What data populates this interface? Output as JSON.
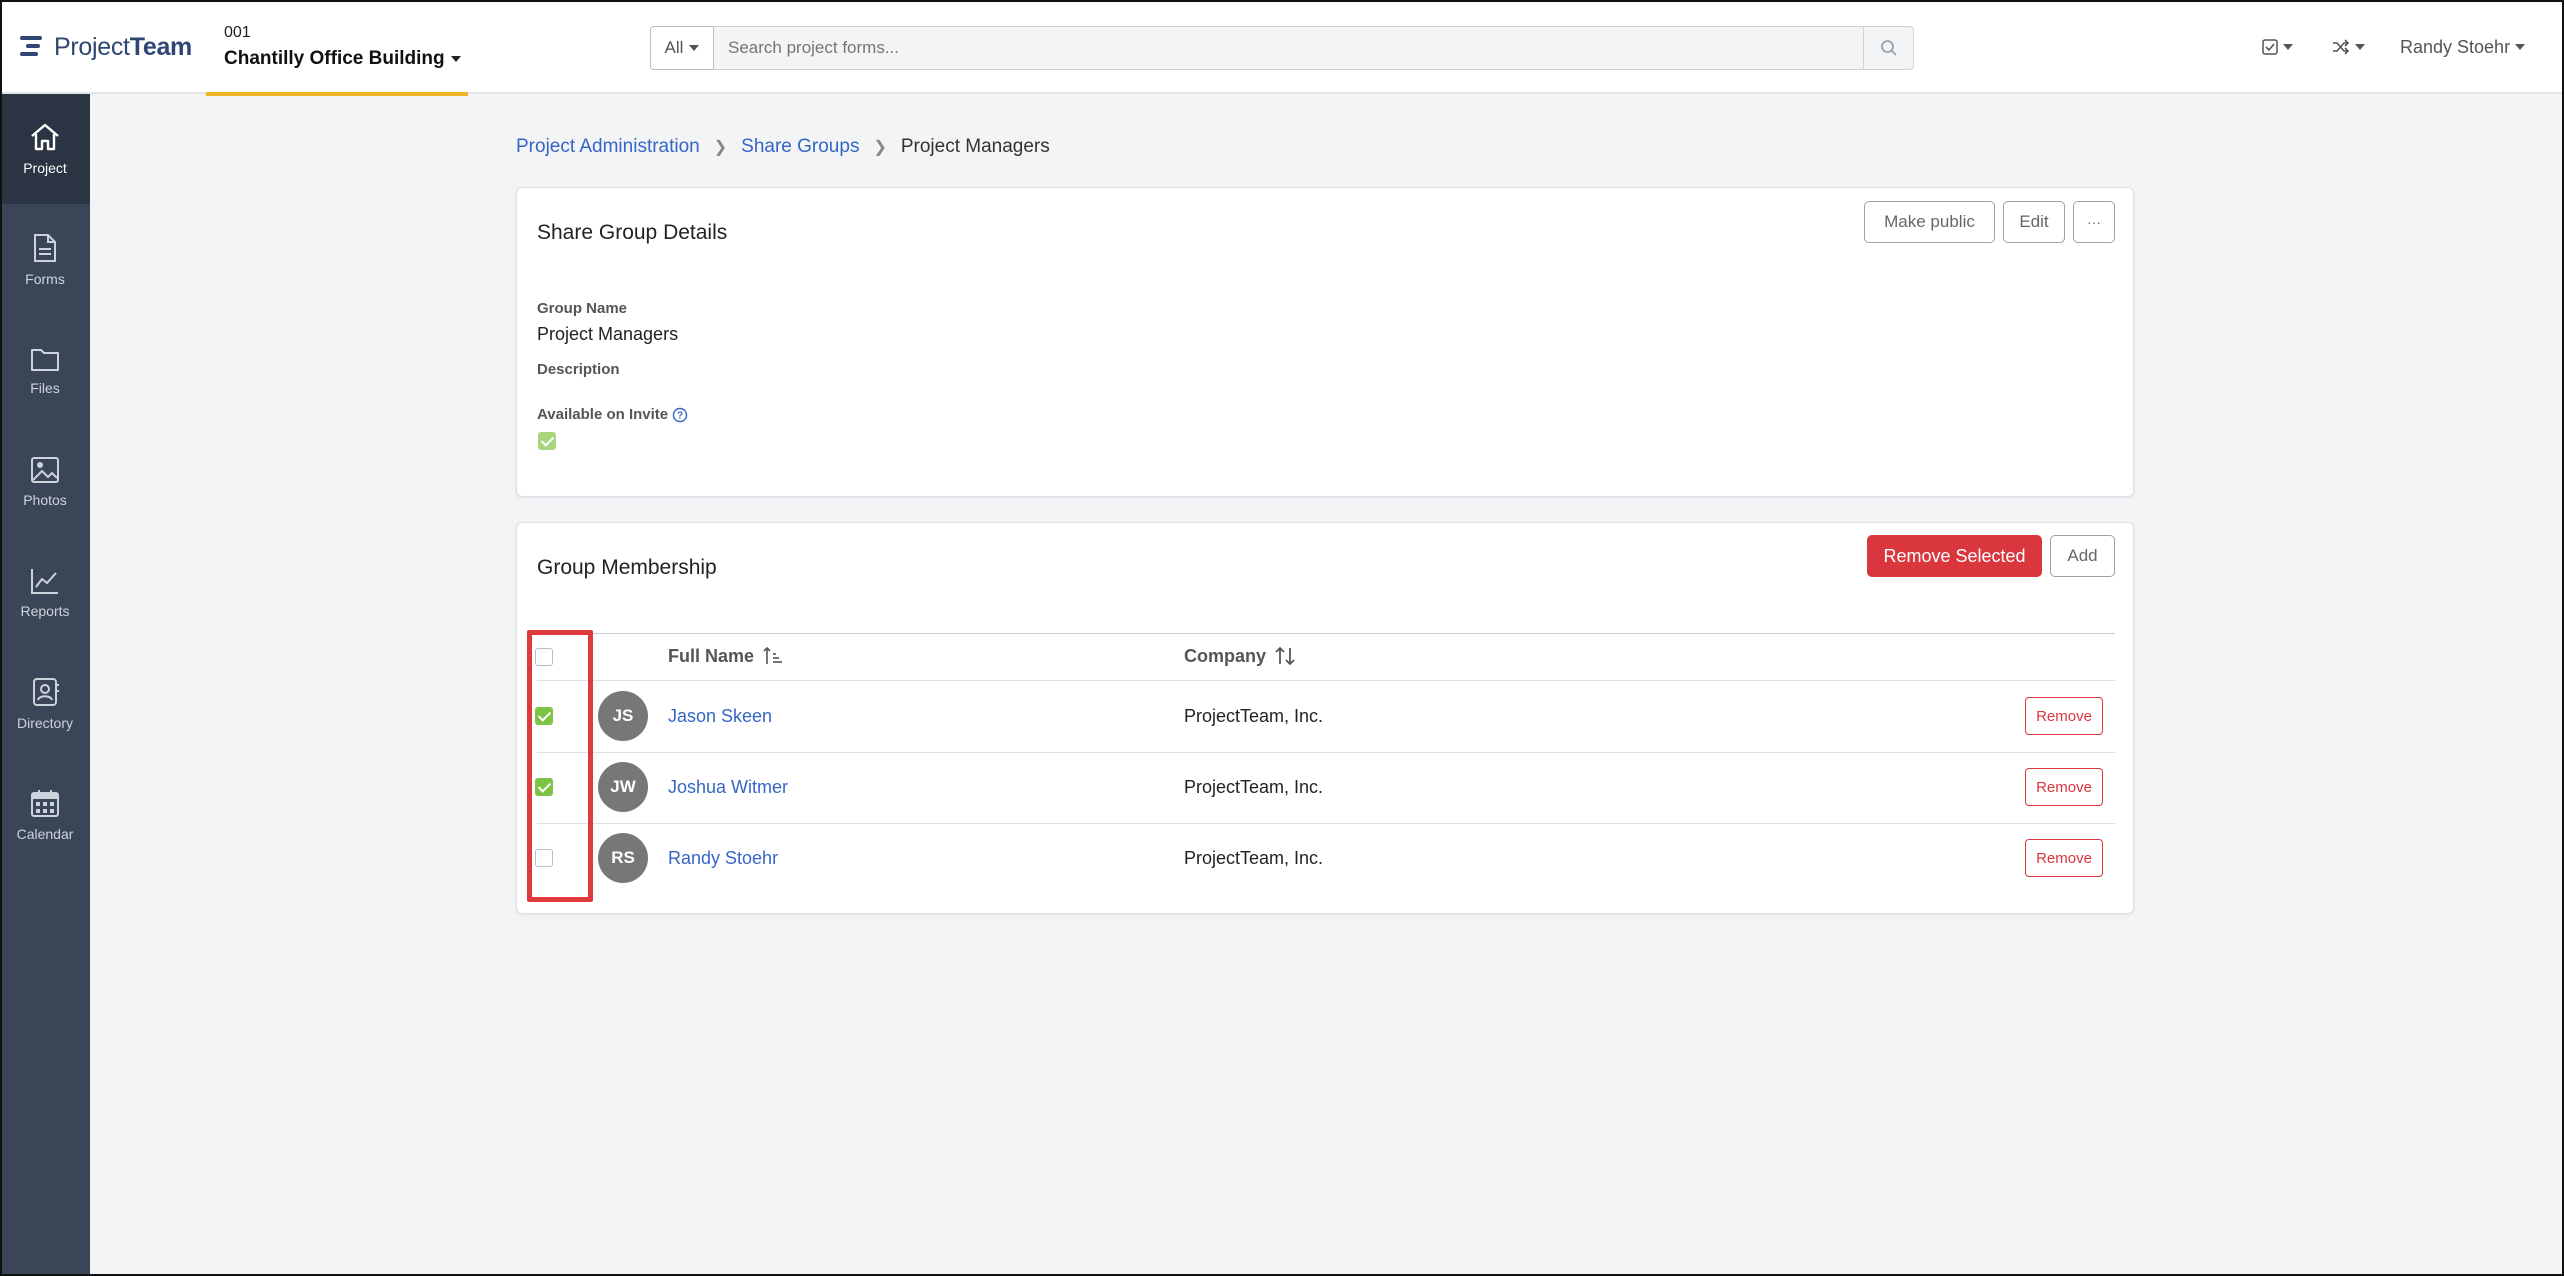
{
  "app": {
    "logo_text_light": "Project",
    "logo_text_bold": "Team",
    "brand_color": "#2f4672",
    "accent_color": "#f0b429"
  },
  "project": {
    "number": "001",
    "name": "Chantilly Office Building"
  },
  "search": {
    "scope": "All",
    "placeholder": "Search project forms..."
  },
  "header_right": {
    "tasks_icon": "checkbox-icon",
    "switch_icon": "shuffle-icon",
    "user_name": "Randy Stoehr"
  },
  "sidebar": {
    "items": [
      {
        "label": "Project",
        "icon": "home-icon",
        "active": true
      },
      {
        "label": "Forms",
        "icon": "document-icon",
        "active": false
      },
      {
        "label": "Files",
        "icon": "folder-icon",
        "active": false
      },
      {
        "label": "Photos",
        "icon": "image-icon",
        "active": false
      },
      {
        "label": "Reports",
        "icon": "line-chart-icon",
        "active": false
      },
      {
        "label": "Directory",
        "icon": "contact-book-icon",
        "active": false
      },
      {
        "label": "Calendar",
        "icon": "calendar-icon",
        "active": false
      }
    ]
  },
  "breadcrumb": {
    "items": [
      "Project Administration",
      "Share Groups"
    ],
    "current": "Project Managers"
  },
  "details": {
    "title": "Share Group Details",
    "make_public_label": "Make public",
    "edit_label": "Edit",
    "more_label": "···",
    "group_name_label": "Group Name",
    "group_name_value": "Project Managers",
    "description_label": "Description",
    "available_label": "Available on Invite",
    "available_checked": true
  },
  "membership": {
    "title": "Group Membership",
    "remove_selected_label": "Remove Selected",
    "add_label": "Add",
    "columns": {
      "full_name": "Full Name",
      "company": "Company"
    },
    "remove_label": "Remove",
    "rows": [
      {
        "initials": "JS",
        "name": "Jason Skeen",
        "company": "ProjectTeam, Inc.",
        "checked": true
      },
      {
        "initials": "JW",
        "name": "Joshua Witmer",
        "company": "ProjectTeam, Inc.",
        "checked": true
      },
      {
        "initials": "RS",
        "name": "Randy Stoehr",
        "company": "ProjectTeam, Inc.",
        "checked": false
      }
    ]
  },
  "colors": {
    "danger": "#d9363e",
    "link": "#3566c6",
    "check_green": "#7cc243",
    "sidebar_bg": "#3a4657"
  }
}
